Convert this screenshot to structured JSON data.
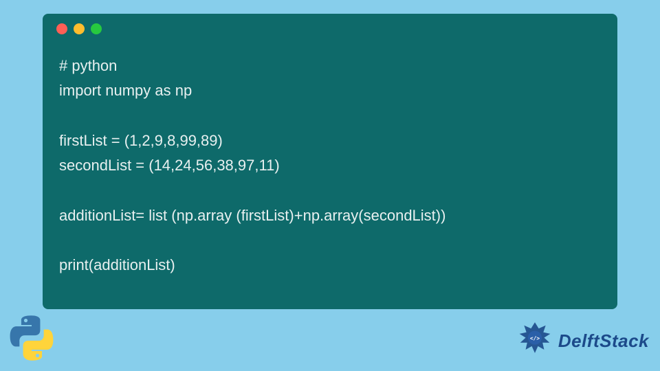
{
  "code": {
    "lines": [
      "# python",
      "import numpy as np",
      "",
      "firstList = (1,2,9,8,99,89)",
      "secondList = (14,24,56,38,97,11)",
      "",
      "additionList= list (np.array (firstList)+np.array(secondList))",
      "",
      "print(additionList)"
    ]
  },
  "branding": {
    "site_name": "DelftStack"
  },
  "colors": {
    "background": "#87ceeb",
    "code_bg": "#0e6a6a",
    "code_text": "#e8f0f0",
    "brand_text": "#1c4a8a"
  }
}
